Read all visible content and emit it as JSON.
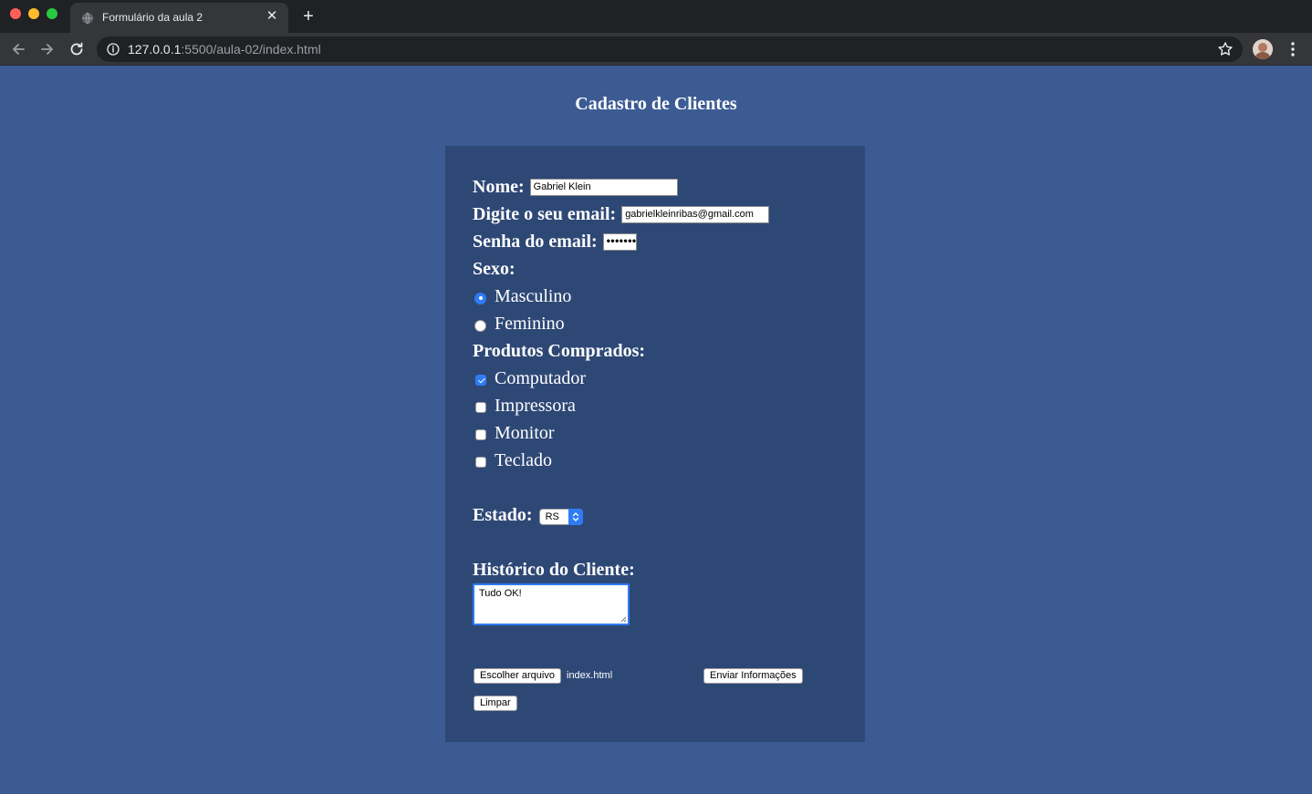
{
  "browser": {
    "tab_title": "Formulário da aula 2",
    "url_host": "127.0.0.1",
    "url_path": ":5500/aula-02/index.html"
  },
  "page": {
    "title": "Cadastro de Clientes"
  },
  "form": {
    "name_label": "Nome:",
    "name_value": "Gabriel Klein",
    "email_label": "Digite o seu email:",
    "email_value": "gabrielkleinribas@gmail.com",
    "password_label": "Senha do email:",
    "password_mask": "•••••••",
    "sex_label": "Sexo:",
    "sex_options": [
      {
        "label": "Masculino",
        "selected": true
      },
      {
        "label": "Feminino",
        "selected": false
      }
    ],
    "products_label": "Produtos Comprados:",
    "products": [
      {
        "label": "Computador",
        "checked": true
      },
      {
        "label": "Impressora",
        "checked": false
      },
      {
        "label": "Monitor",
        "checked": false
      },
      {
        "label": "Teclado",
        "checked": false
      }
    ],
    "state_label": "Estado:",
    "state_value": "RS",
    "history_label": "Histórico do Cliente:",
    "history_value": "Tudo OK!",
    "file_button_label": "Escolher arquivo",
    "file_name": "index.html",
    "submit_label": "Enviar Informações",
    "reset_label": "Limpar"
  },
  "colors": {
    "page_background": "#3c5b93",
    "panel_background": "#2e4876",
    "accent": "#2f7bf5"
  }
}
